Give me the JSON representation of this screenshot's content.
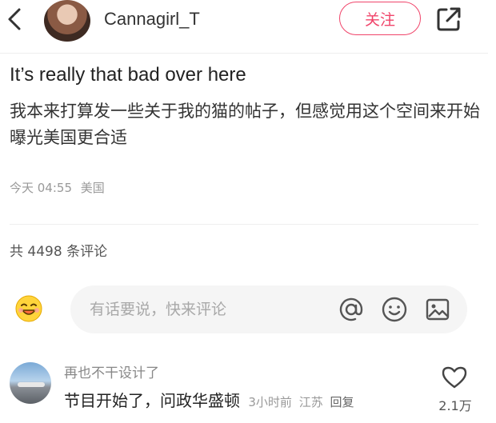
{
  "header": {
    "username": "Cannagirl_T",
    "follow_label": "关注",
    "icons": {
      "back": "chevron-left-icon",
      "share": "share-icon"
    }
  },
  "post": {
    "title": "It’s really that bad over here",
    "body": "我本来打算发一些关于我的猫的帖子，但感觉用这个空间来开始曝光美国更合适",
    "time": "今天 04:55",
    "location": "美国"
  },
  "comments_section": {
    "count_text": "共 4498 条评论",
    "input_placeholder": "有话要说，快来评论",
    "icons": [
      "emoji-sticker-icon",
      "at-icon",
      "smile-icon",
      "image-icon"
    ]
  },
  "comments": [
    {
      "username": "再也不干设计了",
      "text": "节目开始了，问政华盛顿",
      "time": "3小时前",
      "location": "江苏",
      "reply_label": "回复",
      "likes": "2.1万"
    }
  ],
  "colors": {
    "accent": "#f0446a",
    "muted": "#999999",
    "input_bg": "#f5f5f5"
  }
}
